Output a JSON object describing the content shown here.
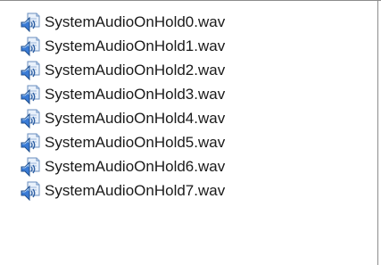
{
  "file_list": {
    "items": [
      {
        "name": "SystemAudioOnHold0.wav",
        "icon": "audio-file-icon"
      },
      {
        "name": "SystemAudioOnHold1.wav",
        "icon": "audio-file-icon"
      },
      {
        "name": "SystemAudioOnHold2.wav",
        "icon": "audio-file-icon"
      },
      {
        "name": "SystemAudioOnHold3.wav",
        "icon": "audio-file-icon"
      },
      {
        "name": "SystemAudioOnHold4.wav",
        "icon": "audio-file-icon"
      },
      {
        "name": "SystemAudioOnHold5.wav",
        "icon": "audio-file-icon"
      },
      {
        "name": "SystemAudioOnHold6.wav",
        "icon": "audio-file-icon"
      },
      {
        "name": "SystemAudioOnHold7.wav",
        "icon": "audio-file-icon"
      }
    ]
  },
  "colors": {
    "background": "#ffffff",
    "text": "#1a1a1a",
    "icon_accent": "#3a7bd5"
  }
}
